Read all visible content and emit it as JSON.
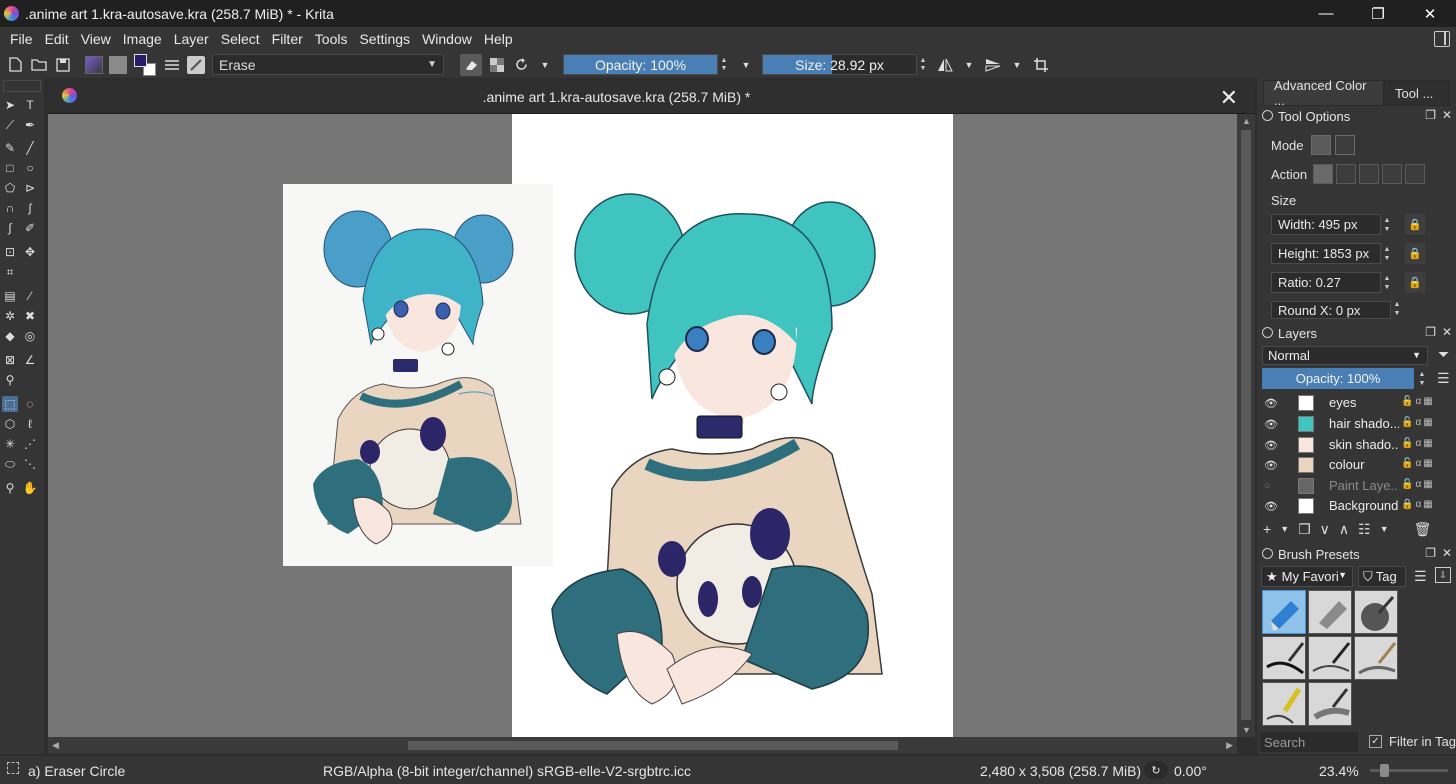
{
  "window": {
    "title": ".anime art 1.kra-autosave.kra (258.7 MiB) * - Krita",
    "controls": [
      "—",
      "❐",
      "✕"
    ]
  },
  "menu": [
    "File",
    "Edit",
    "View",
    "Image",
    "Layer",
    "Select",
    "Filter",
    "Tools",
    "Settings",
    "Window",
    "Help"
  ],
  "toolbar": {
    "brush_preset": "Erase",
    "opacity_label": "Opacity: 100%",
    "opacity_value": 1.0,
    "size_label": "Size: 28.92 px",
    "size_fill": 0.45
  },
  "document": {
    "tab_title": ".anime art 1.kra-autosave.kra (258.7 MiB) *",
    "close_glyph": "✕"
  },
  "docker": {
    "tabs": [
      "Advanced Color ...",
      "Tool ..."
    ],
    "tool_options": {
      "title": "Tool Options",
      "mode_label": "Mode",
      "action_label": "Action",
      "size_label": "Size",
      "width": "Width: 495 px",
      "height": "Height: 1853 px",
      "ratio": "Ratio: 0.27",
      "round_x": "Round X: 0 px"
    },
    "layers": {
      "title": "Layers",
      "blend_mode": "Normal",
      "opacity": "Opacity:  100%",
      "items": [
        {
          "name": "eyes",
          "visible": true
        },
        {
          "name": "hair shado...",
          "visible": true
        },
        {
          "name": "skin shado...",
          "visible": true
        },
        {
          "name": "colour",
          "visible": true
        },
        {
          "name": "Paint Laye...",
          "visible": false
        },
        {
          "name": "Background",
          "visible": true
        }
      ]
    },
    "brush_presets": {
      "title": "Brush Presets",
      "favorites": "My Favori",
      "tag": "Tag",
      "search_placeholder": "Search",
      "filter_in_tag": "Filter in Tag"
    }
  },
  "statusbar": {
    "tool": "a) Eraser Circle",
    "color_space": "RGB/Alpha (8-bit integer/channel)  sRGB-elle-V2-srgbtrc.icc",
    "dimensions": "2,480 x 3,508 (258.7 MiB)",
    "rotation": "0.00°",
    "zoom": "23.4%"
  },
  "colors": {
    "accent": "#4a7fb5",
    "canvas_bg": "#767676",
    "panel_bg": "#353535",
    "hair": "#3fc4c0",
    "sweater": "#ead6c0",
    "sleeve": "#2f6f7d"
  }
}
